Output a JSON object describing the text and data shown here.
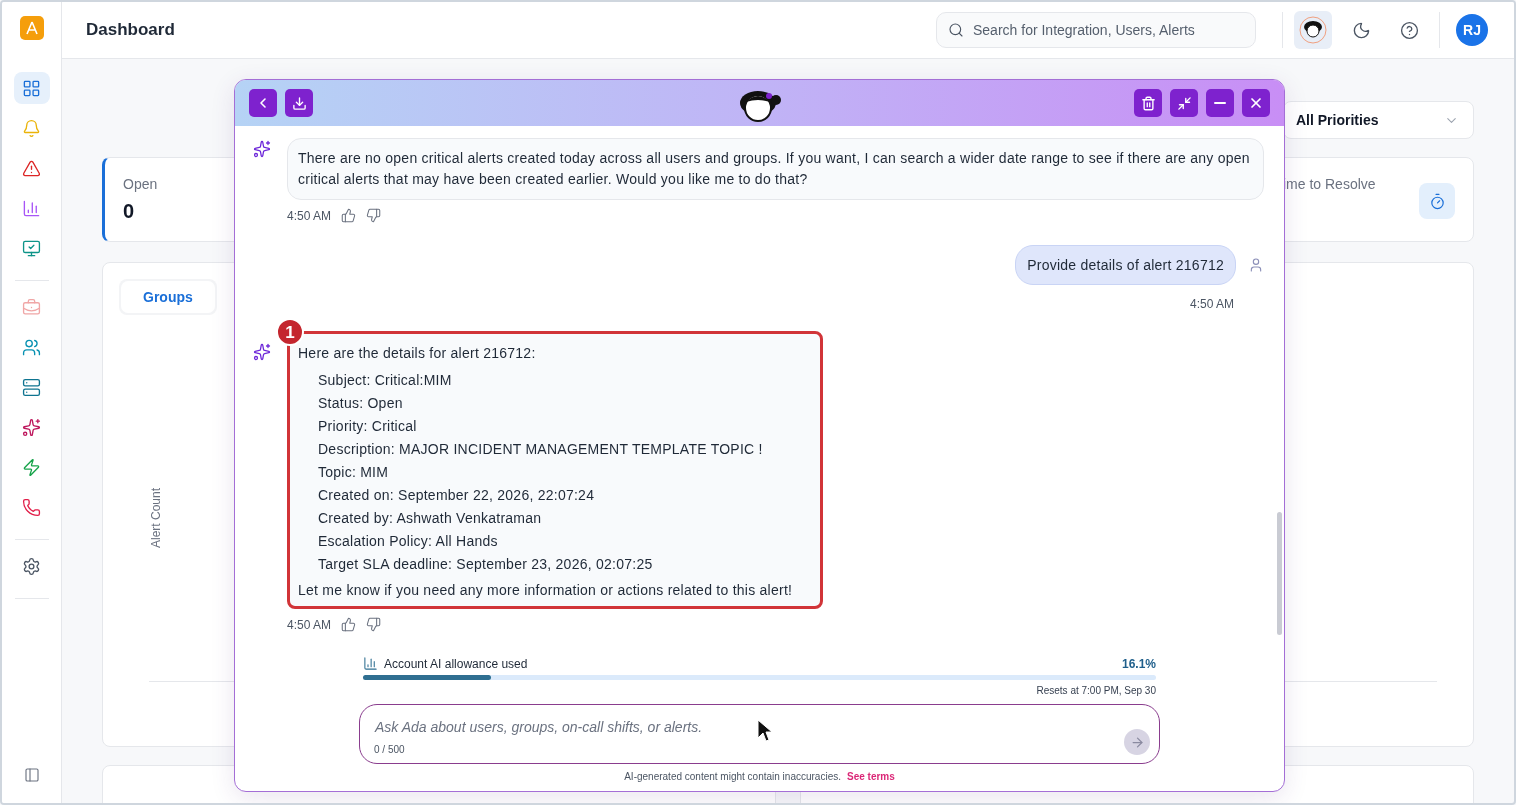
{
  "header": {
    "title": "Dashboard",
    "search": {
      "placeholder": "Search for Integration, Users, Alerts"
    },
    "avatar": "RJ"
  },
  "sidebar": {
    "sections": [
      {
        "items": [
          {
            "selected": true
          },
          {
            "selected": false
          },
          {
            "selected": false
          },
          {
            "selected": false
          },
          {
            "selected": false
          }
        ]
      },
      {
        "items": [
          {
            "selected": false
          },
          {
            "selected": false
          },
          {
            "selected": false
          },
          {
            "selected": false
          },
          {
            "selected": false
          },
          {
            "selected": false
          }
        ]
      },
      {
        "items": [
          {
            "selected": false
          }
        ]
      }
    ]
  },
  "filters": {
    "priority": "All Priorities"
  },
  "stats": [
    {
      "label": "Open",
      "value": "0"
    },
    {
      "label": "ime to Resolve"
    }
  ],
  "chart_card": {
    "tabs": [
      {
        "label": "Groups",
        "selected": true
      }
    ],
    "ylabel": "Alert Count"
  },
  "chat": {
    "messages": [
      {
        "kind": "bot",
        "text": "There are no open critical alerts created today across all users and groups. If you want, I can search a wider date range to see if there are any open critical alerts that may have been created earlier. Would you like me to do that?",
        "time": "4:50 AM",
        "highlighted": false
      },
      {
        "kind": "user",
        "text": "Provide details of alert 216712",
        "time": "4:50 AM"
      },
      {
        "kind": "bot",
        "intro": "Here are the details for alert 216712:",
        "details": [
          "Subject: Critical:MIM",
          "Status: Open",
          "Priority: Critical",
          "Description: MAJOR INCIDENT MANAGEMENT TEMPLATE TOPIC !",
          "Topic: MIM",
          "Created on: September 22, 2026, 22:07:24",
          "Created by: Ashwath Venkatraman",
          "Escalation Policy: All Hands",
          "Target SLA deadline: September 23, 2026, 02:07:25"
        ],
        "outro": "Let me know if you need any more information or actions related to this alert!",
        "time": "4:50 AM",
        "highlighted": true,
        "annotation": "1"
      }
    ],
    "allowance": {
      "label": "Account AI allowance used",
      "reading": "16.1%",
      "level": 0.161,
      "resets": "Resets at 7:00 PM, Sep 30"
    },
    "input": {
      "placeholder": "Ask Ada about users, groups, on-call shifts, or alerts.",
      "counter": "0 / 500"
    },
    "disclaimer": {
      "text": "AI-generated content might contain inaccuracies.",
      "link": "See terms"
    }
  }
}
